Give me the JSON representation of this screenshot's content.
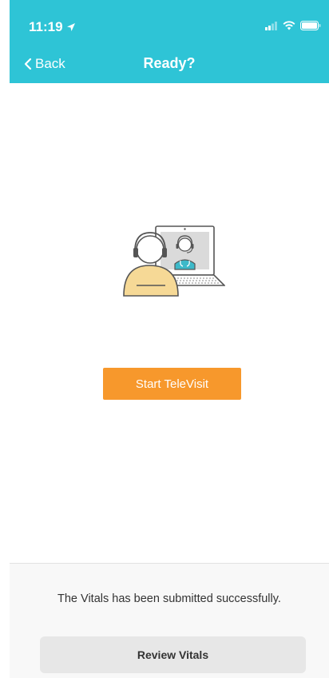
{
  "status_bar": {
    "time": "11:19",
    "icons": [
      "location-arrow-icon",
      "signal-icon",
      "wifi-icon",
      "battery-icon"
    ]
  },
  "nav": {
    "back_label": "Back",
    "title": "Ready?"
  },
  "illustration": {
    "icon": "televisit-illustration"
  },
  "actions": {
    "start_label": "Start TeleVisit"
  },
  "footer": {
    "message": "The Vitals has been submitted successfully.",
    "review_label": "Review Vitals"
  },
  "colors": {
    "header_bg": "#2ec4d6",
    "primary_button": "#f7982c",
    "secondary_button": "#e7e7e7",
    "patient_body": "#f6d996",
    "doctor_teal": "#3db9c9"
  }
}
